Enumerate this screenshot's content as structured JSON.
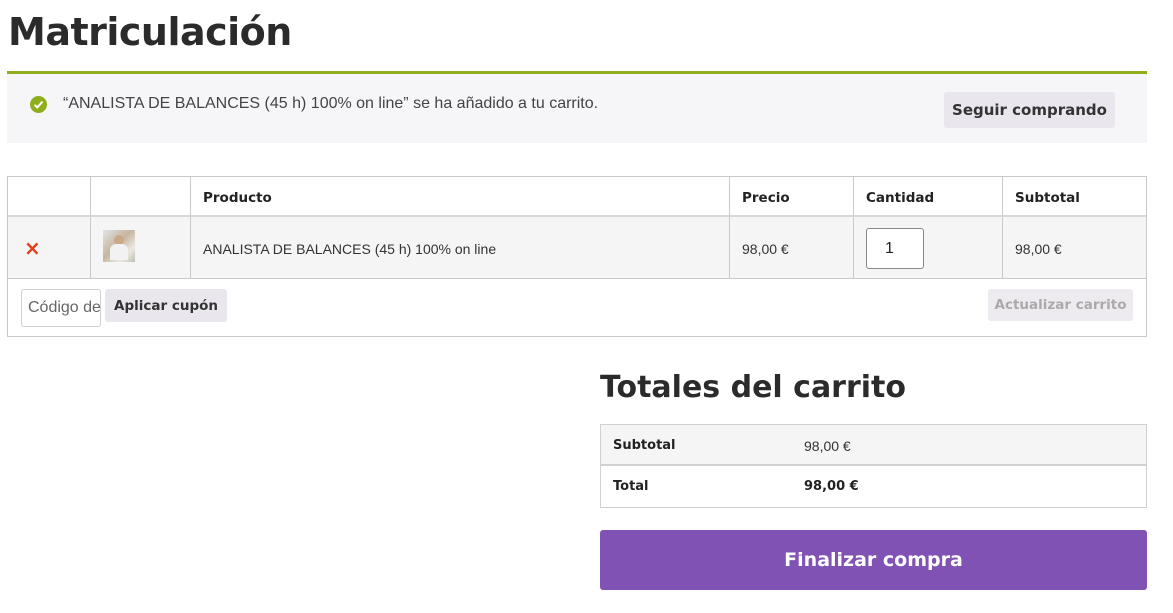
{
  "page": {
    "title": "Matriculación"
  },
  "notice": {
    "message": "“ANALISTA DE BALANCES (45 h) 100% on line” se ha añadido a tu carrito.",
    "continue_label": "Seguir comprando",
    "accent_color": "#8fae1b"
  },
  "cart": {
    "headers": {
      "remove": "",
      "thumbnail": "",
      "product": "Producto",
      "price": "Precio",
      "quantity": "Cantidad",
      "subtotal": "Subtotal"
    },
    "items": [
      {
        "name": "ANALISTA DE BALANCES (45 h) 100% on line",
        "price": "98,00 €",
        "quantity": "1",
        "subtotal": "98,00 €",
        "remove_icon": "×"
      }
    ],
    "coupon_placeholder": "Código de cupón",
    "apply_label": "Aplicar cupón",
    "update_label": "Actualizar carrito"
  },
  "totals": {
    "title": "Totales del carrito",
    "subtotal_label": "Subtotal",
    "subtotal_value": "98,00 €",
    "total_label": "Total",
    "total_value": "98,00 €"
  },
  "checkout": {
    "label": "Finalizar compra",
    "color": "#8052b3"
  }
}
